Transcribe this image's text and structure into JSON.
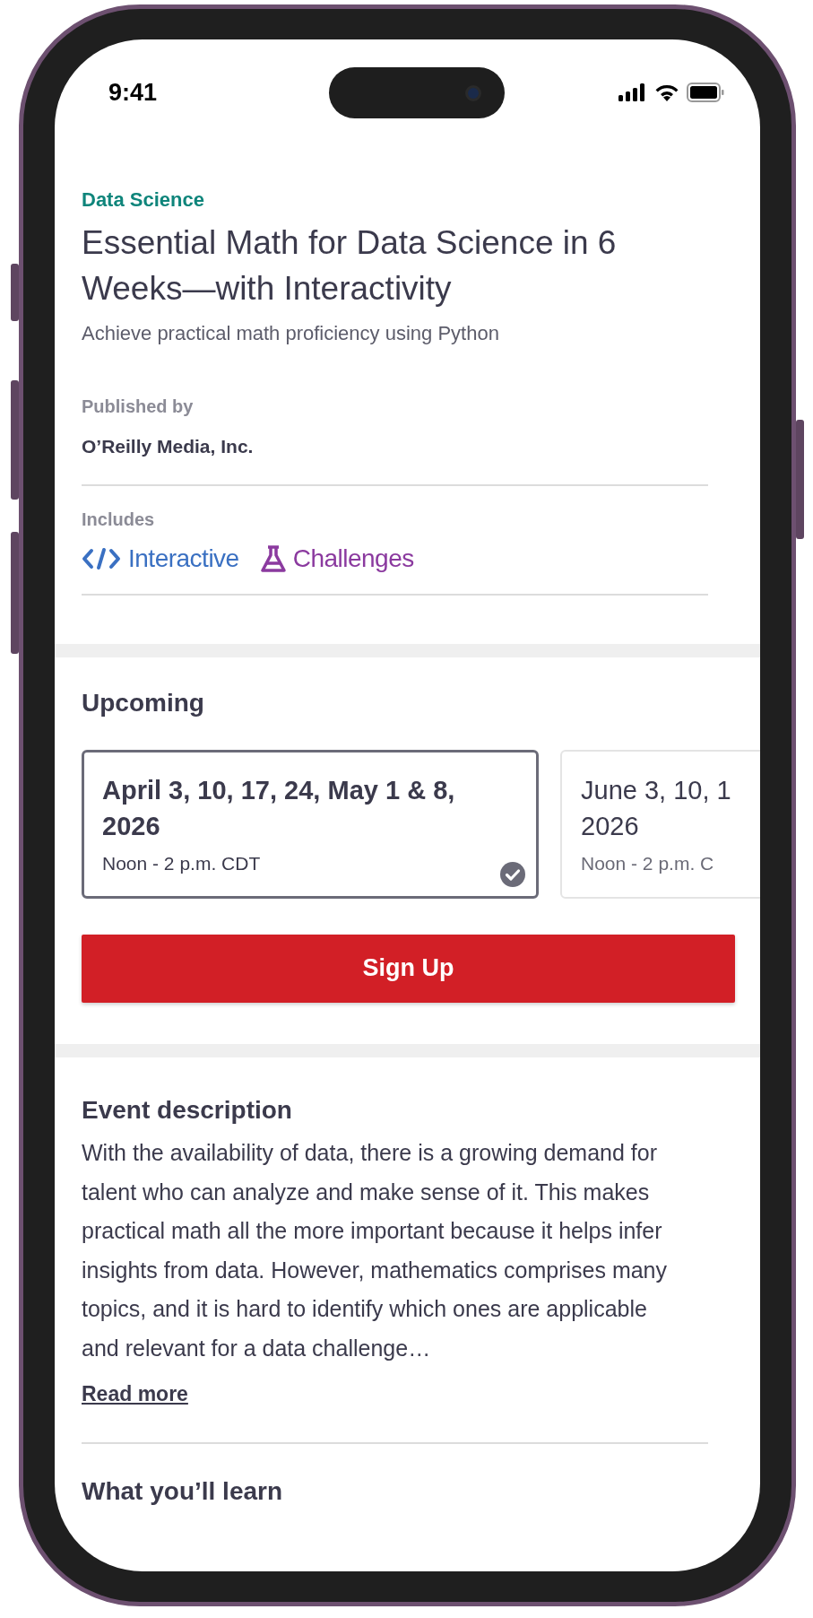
{
  "status_bar": {
    "time": "9:41"
  },
  "course": {
    "category": "Data Science",
    "title": "Essential Math for Data Science in 6 Weeks—with Interactivity",
    "subtitle": "Achieve practical math proficiency using Python"
  },
  "publisher": {
    "label": "Published by",
    "name": "O’Reilly Media, Inc."
  },
  "includes": {
    "label": "Includes",
    "features": [
      {
        "kind": "interactive",
        "label": "Interactive",
        "color": "#3a70c2"
      },
      {
        "kind": "challenges",
        "label": "Challenges",
        "color": "#8b3a9f"
      }
    ]
  },
  "upcoming": {
    "heading": "Upcoming",
    "sessions": [
      {
        "dates": "April 3, 10, 17, 24, May 1 & 8, 2026",
        "time": "Noon - 2 p.m. CDT",
        "selected": true
      },
      {
        "dates": "June 3, 10, 1 2026",
        "time": "Noon - 2 p.m. C",
        "selected": false
      }
    ]
  },
  "sign_up_button": "Sign Up",
  "event_description": {
    "heading": "Event description",
    "text": "With the availability of data, there is a growing demand for talent who can analyze and make sense of it. This makes practical math all the more important because it helps infer insights from data. However, mathematics comprises many topics, and it is hard to identify which ones are applicable and relevant for a data challenge…",
    "link": "Read more"
  },
  "next_section": {
    "heading": "What you’ll learn"
  }
}
